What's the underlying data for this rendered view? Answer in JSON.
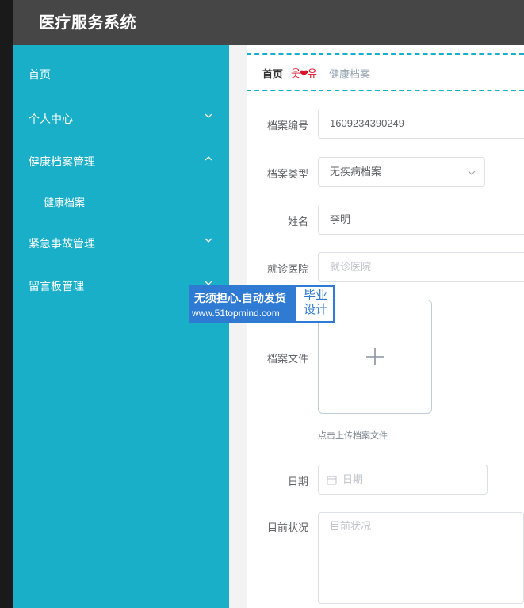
{
  "app": {
    "title": "医疗服务系统"
  },
  "sidebar": {
    "items": [
      {
        "label": "首页",
        "icon": ""
      },
      {
        "label": "个人中心",
        "icon": "chevron-down-icon"
      },
      {
        "label": "健康档案管理",
        "icon": "chevron-up-icon"
      },
      {
        "label": "健康档案",
        "icon": ""
      },
      {
        "label": "紧急事故管理",
        "icon": "chevron-down-icon"
      },
      {
        "label": "留言板管理",
        "icon": "chevron-down-icon"
      }
    ]
  },
  "breadcrumb": {
    "home": "首页",
    "separator": "웃❤유",
    "current": "健康档案"
  },
  "form": {
    "archive_no": {
      "label": "档案编号",
      "value": "1609234390249"
    },
    "archive_type": {
      "label": "档案类型",
      "value": "无疾病档案"
    },
    "name": {
      "label": "姓名",
      "value": "李明"
    },
    "hospital": {
      "label": "就诊医院",
      "placeholder": "就诊医院"
    },
    "file": {
      "label": "档案文件",
      "hint": "点击上传档案文件"
    },
    "date": {
      "label": "日期",
      "placeholder": "日期"
    },
    "status": {
      "label": "目前状况",
      "placeholder": "目前状况"
    }
  },
  "watermark": {
    "line1": "无须担心.自动发货",
    "line2": "www.51topmind.com",
    "right1": "毕业",
    "right2": "设计"
  },
  "colors": {
    "sidebar": "#1aafc9",
    "topbar": "#464646",
    "accent_dash": "#1aafc9",
    "watermark": "#2f7bd3"
  }
}
